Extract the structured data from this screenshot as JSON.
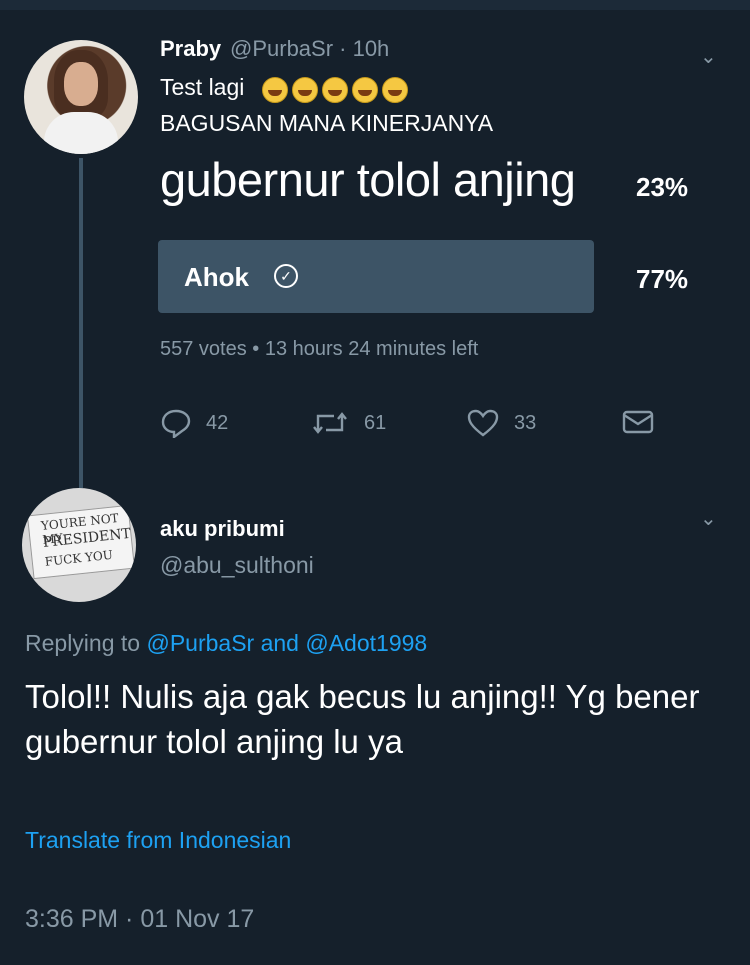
{
  "tweet1": {
    "name": "Praby",
    "handle_time": "@PurbaSr · 10h",
    "text_line1": "Test lagi",
    "text_line2": "BAGUSAN MANA KINERJANYA",
    "poll": {
      "options": [
        {
          "label": "gubernur tolol anjing",
          "percent": "23%",
          "fraction": 0.23
        },
        {
          "label": "Ahok",
          "percent": "77%",
          "fraction": 0.77
        }
      ],
      "meta": "557 votes • 13 hours 24 minutes left"
    },
    "actions": {
      "reply": "42",
      "retweet": "61",
      "like": "33"
    }
  },
  "tweet2": {
    "name": "aku pribumi",
    "handle": "@abu_sulthoni",
    "avatar_text": [
      "YOURE NOT MY",
      "PRESIDENT",
      "FUCK YOU"
    ],
    "replying_prefix": "Replying to",
    "replying_user1": "@PurbaSr",
    "replying_and": "and",
    "replying_user2": "@Adot1998",
    "body": "Tolol!! Nulis aja gak becus lu anjing!! Yg bener gubernur tolol anjing lu ya",
    "translate": "Translate from Indonesian",
    "timestamp": "3:36 PM · 01 Nov 17"
  },
  "colors": {
    "background": "#15202b",
    "muted": "#8899a6",
    "link": "#1da1f2",
    "poll_bar": "#3d5466"
  }
}
